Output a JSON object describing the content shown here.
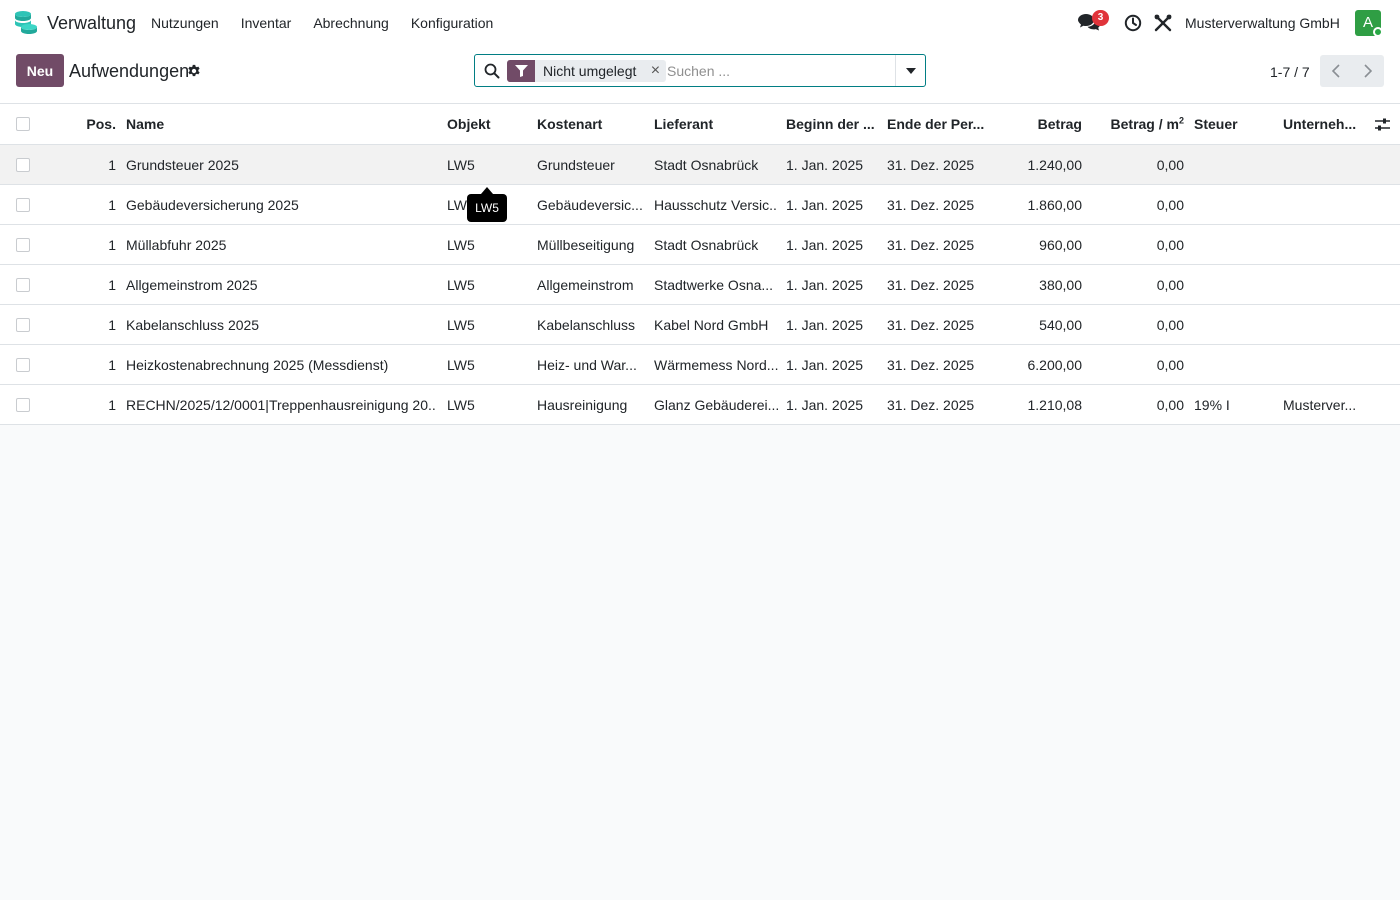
{
  "app": {
    "name": "Verwaltung",
    "logo_icon": "database-stack-icon"
  },
  "menu": {
    "items": [
      "Nutzungen",
      "Inventar",
      "Abrechnung",
      "Konfiguration"
    ]
  },
  "systray": {
    "chat_badge": "3",
    "company": "Musterverwaltung GmbH",
    "avatar_letter": "A"
  },
  "control": {
    "new_label": "Neu",
    "title": "Aufwendungen",
    "search": {
      "facet_label": "Nicht umgelegt",
      "facet_close": "×",
      "placeholder": "Suchen ..."
    },
    "pager": "1-7 / 7"
  },
  "table": {
    "headers": {
      "pos": "Pos.",
      "name": "Name",
      "objekt": "Objekt",
      "kostenart": "Kostenart",
      "lieferant": "Lieferant",
      "beginn": "Beginn der ...",
      "ende": "Ende der Per...",
      "betrag": "Betrag",
      "betrag_qm": "Betrag / m",
      "betrag_qm_sup": "2",
      "steuer": "Steuer",
      "unternehmen": "Unterneh..."
    },
    "rows": [
      {
        "pos": "1",
        "name": "Grundsteuer 2025",
        "objekt": "LW5",
        "kostenart": "Grundsteuer",
        "lieferant": "Stadt Osnabrück",
        "beginn": "1. Jan. 2025",
        "ende": "31. Dez. 2025",
        "betrag": "1.240,00",
        "betrag_qm": "0,00",
        "steuer": "",
        "unternehmen": ""
      },
      {
        "pos": "1",
        "name": "Gebäudeversicherung 2025",
        "objekt": "LW5",
        "kostenart": "Gebäudeversic...",
        "lieferant": "Hausschutz Versic...",
        "beginn": "1. Jan. 2025",
        "ende": "31. Dez. 2025",
        "betrag": "1.860,00",
        "betrag_qm": "0,00",
        "steuer": "",
        "unternehmen": ""
      },
      {
        "pos": "1",
        "name": "Müllabfuhr 2025",
        "objekt": "LW5",
        "kostenart": "Müllbeseitigung",
        "lieferant": "Stadt Osnabrück",
        "beginn": "1. Jan. 2025",
        "ende": "31. Dez. 2025",
        "betrag": "960,00",
        "betrag_qm": "0,00",
        "steuer": "",
        "unternehmen": ""
      },
      {
        "pos": "1",
        "name": "Allgemeinstrom 2025",
        "objekt": "LW5",
        "kostenart": "Allgemeinstrom",
        "lieferant": "Stadtwerke Osna...",
        "beginn": "1. Jan. 2025",
        "ende": "31. Dez. 2025",
        "betrag": "380,00",
        "betrag_qm": "0,00",
        "steuer": "",
        "unternehmen": ""
      },
      {
        "pos": "1",
        "name": "Kabelanschluss 2025",
        "objekt": "LW5",
        "kostenart": "Kabelanschluss",
        "lieferant": "Kabel Nord GmbH",
        "beginn": "1. Jan. 2025",
        "ende": "31. Dez. 2025",
        "betrag": "540,00",
        "betrag_qm": "0,00",
        "steuer": "",
        "unternehmen": ""
      },
      {
        "pos": "1",
        "name": "Heizkostenabrechnung 2025 (Messdienst)",
        "objekt": "LW5",
        "kostenart": "Heiz- und War...",
        "lieferant": "Wärmemess Nord...",
        "beginn": "1. Jan. 2025",
        "ende": "31. Dez. 2025",
        "betrag": "6.200,00",
        "betrag_qm": "0,00",
        "steuer": "",
        "unternehmen": ""
      },
      {
        "pos": "1",
        "name": "RECHN/2025/12/0001|Treppenhausreinigung 20...",
        "objekt": "LW5",
        "kostenart": "Hausreinigung",
        "lieferant": "Glanz Gebäuderei...",
        "beginn": "1. Jan. 2025",
        "ende": "31. Dez. 2025",
        "betrag": "1.210,08",
        "betrag_qm": "0,00",
        "steuer": "19% I",
        "unternehmen": "Musterver..."
      }
    ]
  },
  "tooltip": {
    "text": "LW5"
  },
  "colors": {
    "brand": "#714b67",
    "accent": "#017e84",
    "badge": "#e0343b",
    "avatar": "#2f9e44"
  }
}
